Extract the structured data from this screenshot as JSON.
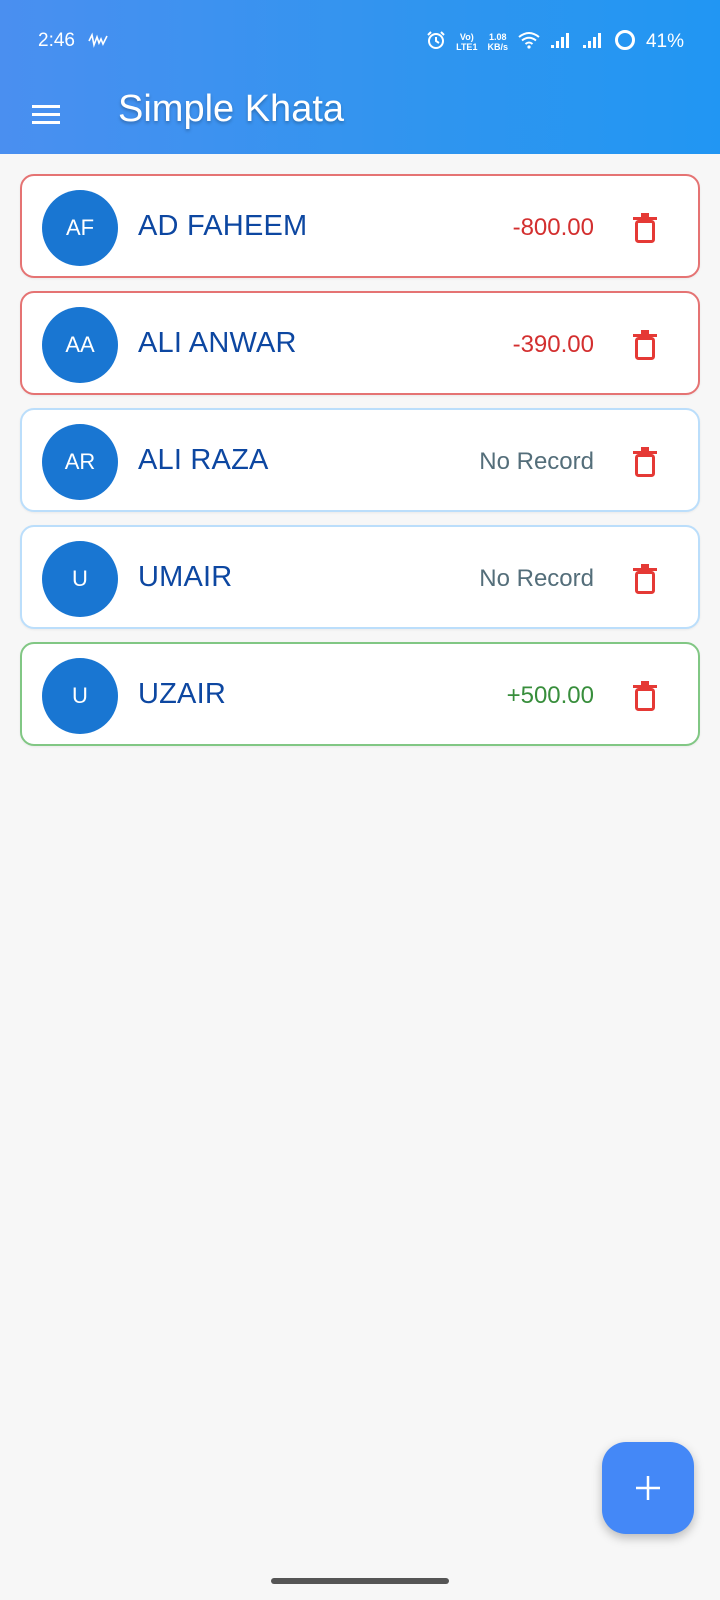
{
  "status_bar": {
    "time": "2:46",
    "network_label_top": "Vo)",
    "network_label_bottom": "LTE1",
    "speed_value": "1.08",
    "speed_unit": "KB/s",
    "battery": "41%",
    "icons": [
      "activity-icon",
      "alarm-icon",
      "wifi-icon",
      "signal-icon",
      "signal-icon",
      "battery-icon"
    ]
  },
  "app_bar": {
    "title": "Simple Khata",
    "menu_icon": "hamburger-menu-icon"
  },
  "customers": [
    {
      "initials": "AF",
      "name": "AD FAHEEM",
      "balance": "-800.00",
      "status": "negative"
    },
    {
      "initials": "AA",
      "name": "ALI ANWAR",
      "balance": "-390.00",
      "status": "negative"
    },
    {
      "initials": "AR",
      "name": "ALI RAZA",
      "balance": "No Record",
      "status": "neutral"
    },
    {
      "initials": "U",
      "name": "UMAIR",
      "balance": "No Record",
      "status": "neutral"
    },
    {
      "initials": "U",
      "name": "UZAIR",
      "balance": "+500.00",
      "status": "positive"
    }
  ],
  "fab": {
    "icon": "plus-icon"
  },
  "colors": {
    "primary": "#2196f3",
    "avatar": "#1976d2",
    "name_text": "#0d47a1",
    "negative": "#d32f2f",
    "positive": "#388e3c",
    "neutral_text": "#546e7a",
    "delete": "#e53935"
  }
}
